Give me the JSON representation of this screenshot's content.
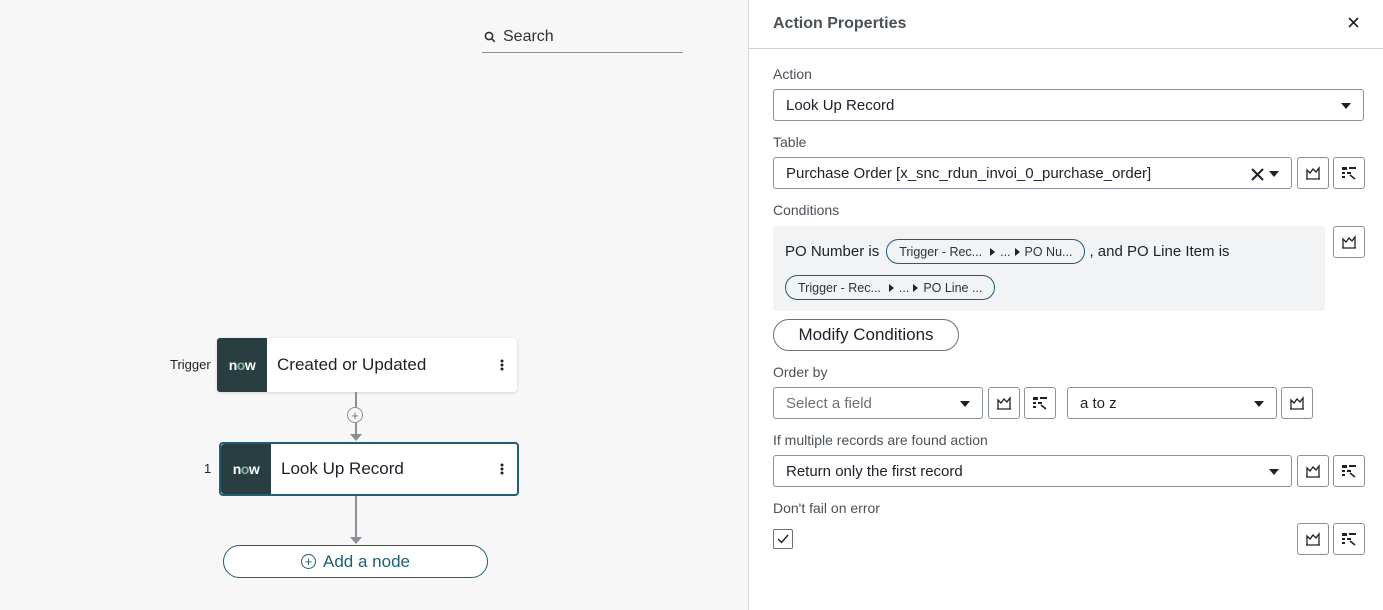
{
  "canvas": {
    "search_placeholder": "Search",
    "trigger": {
      "label": "Trigger",
      "logo": "now",
      "title": "Created or Updated"
    },
    "step1": {
      "number": "1",
      "logo": "now",
      "title": "Look Up Record"
    },
    "add_node_label": "Add a node"
  },
  "panel": {
    "title": "Action Properties",
    "action": {
      "label": "Action",
      "value": "Look Up Record"
    },
    "table": {
      "label": "Table",
      "value": "Purchase Order [x_snc_rdun_invoi_0_purchase_order]"
    },
    "conditions": {
      "label": "Conditions",
      "text1": "PO Number is",
      "pill1": [
        "Trigger - Rec...",
        "...",
        "PO Nu..."
      ],
      "text2": ", and PO Line Item is",
      "pill2": [
        "Trigger - Rec...",
        "...",
        "PO Line ..."
      ]
    },
    "modify_conditions_label": "Modify Conditions",
    "order_by": {
      "label": "Order by",
      "field_placeholder": "Select a field",
      "direction": "a to z"
    },
    "multiple_records": {
      "label": "If multiple records are found action",
      "value": "Return only the first record"
    },
    "dont_fail": {
      "label": "Don't fail on error",
      "checked": true
    }
  },
  "colors": {
    "accent": "#1f5e73",
    "logo_bg": "#293e40",
    "logo_o": "#81b5a1"
  }
}
